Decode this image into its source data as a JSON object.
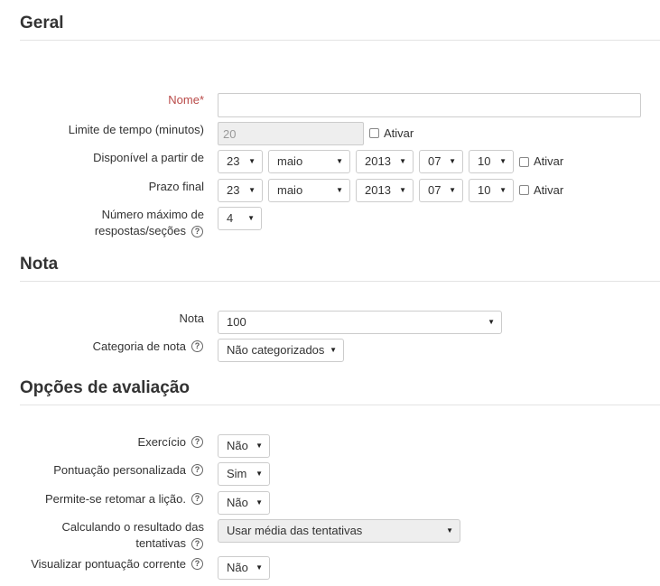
{
  "sections": {
    "geral": "Geral",
    "nota": "Nota",
    "opcoes": "Opções de avaliação"
  },
  "fields": {
    "nome": {
      "label": "Nome",
      "required_mark": "*",
      "value": ""
    },
    "limite": {
      "label": "Limite de tempo (minutos)",
      "value": "20",
      "enable_label": "Ativar"
    },
    "disponivel": {
      "label": "Disponível a partir de",
      "day": "23",
      "month": "maio",
      "year": "2013",
      "hour": "07",
      "minute": "10",
      "enable_label": "Ativar"
    },
    "prazo": {
      "label": "Prazo final",
      "day": "23",
      "month": "maio",
      "year": "2013",
      "hour": "07",
      "minute": "10",
      "enable_label": "Ativar"
    },
    "max_respostas": {
      "label_line1": "Número máximo de",
      "label_line2": "respostas/seções",
      "value": "4"
    },
    "nota": {
      "label": "Nota",
      "value": "100"
    },
    "categoria": {
      "label": "Categoria de nota",
      "value": "Não categorizados"
    },
    "exercicio": {
      "label": "Exercício",
      "value": "Não"
    },
    "pontuacao_personalizada": {
      "label": "Pontuação personalizada",
      "value": "Sim"
    },
    "retomar": {
      "label": "Permite-se retomar a lição.",
      "value": "Não"
    },
    "calculando": {
      "label_line1": "Calculando o resultado das",
      "label_line2": "tentativas",
      "value": "Usar média das tentativas"
    },
    "visualizar": {
      "label": "Visualizar pontuação corrente",
      "value": "Não"
    }
  },
  "icons": {
    "help": "?",
    "caret": "▼"
  }
}
